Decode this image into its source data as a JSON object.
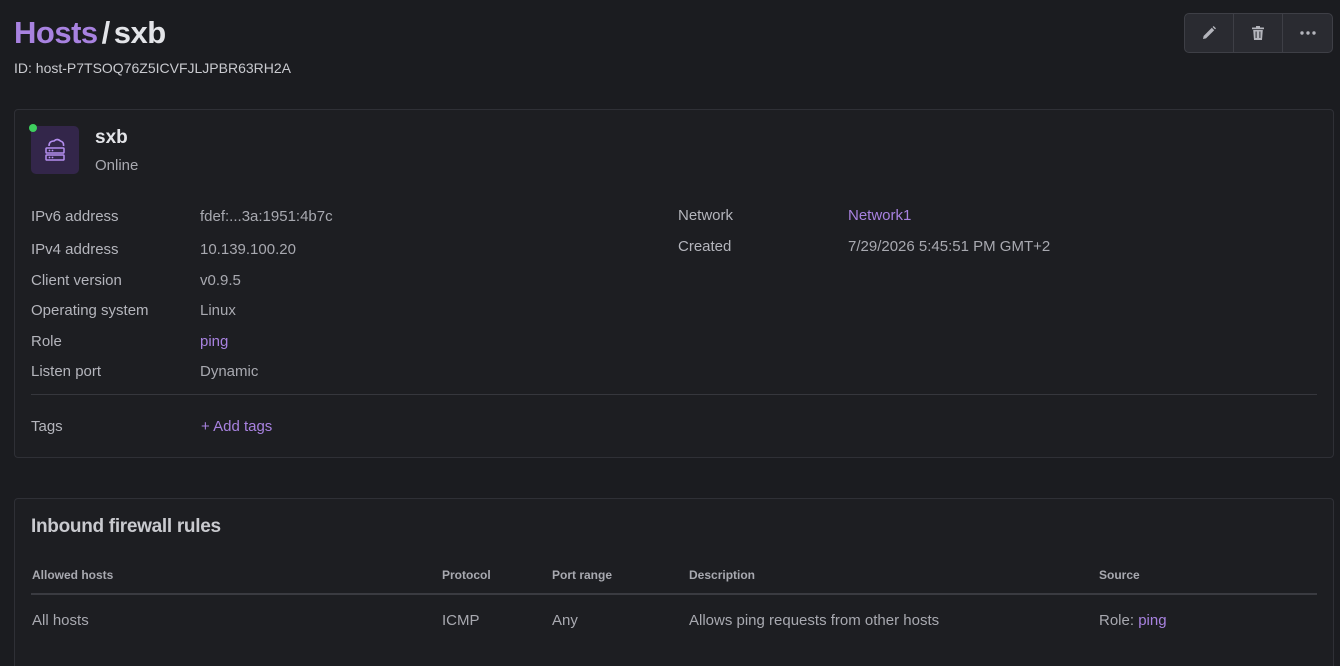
{
  "header": {
    "breadcrumb_parent": "Hosts",
    "separator": "/",
    "current": "sxb",
    "id_text": "ID: host-P7TSOQ76Z5ICVFJLJPBR63RH2A"
  },
  "toolbar": {
    "edit_icon": "pencil-icon",
    "delete_icon": "trash-icon",
    "more_icon": "more-horizontal-icon"
  },
  "host": {
    "name": "sxb",
    "status": "Online",
    "status_color": "#3ecf5e",
    "icon": "cloud-server-icon"
  },
  "details_left": [
    {
      "label": "IPv6 address",
      "value": "fdef:...3a:1951:4b7c"
    },
    {
      "label": "IPv4 address",
      "value": "10.139.100.20"
    },
    {
      "label": "Client version",
      "value": "v0.9.5"
    },
    {
      "label": "Operating system",
      "value": "Linux"
    },
    {
      "label": "Role",
      "value": "ping"
    },
    {
      "label": "Listen port",
      "value": "Dynamic"
    }
  ],
  "details_right": [
    {
      "label": "Network",
      "value": "Network1"
    },
    {
      "label": "Created",
      "value": "7/29/2026 5:45:51 PM GMT+2"
    }
  ],
  "tags": {
    "label": "Tags",
    "add_label": "+ Add tags"
  },
  "firewall": {
    "title": "Inbound firewall rules",
    "columns": [
      "Allowed hosts",
      "Protocol",
      "Port range",
      "Description",
      "Source"
    ],
    "rows": [
      {
        "allowed_hosts": "All hosts",
        "protocol": "ICMP",
        "port_range": "Any",
        "description": "Allows ping requests from other hosts",
        "source_prefix": "Role:",
        "source_link": "ping"
      }
    ]
  },
  "colors": {
    "accent": "#a882e0",
    "background": "#1b1c20",
    "online": "#3ecf5e"
  }
}
